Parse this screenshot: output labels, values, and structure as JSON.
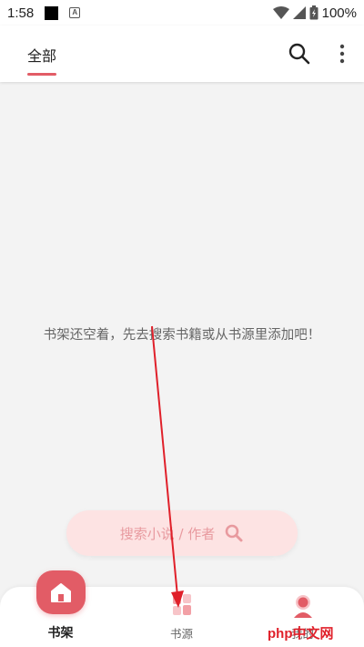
{
  "status_bar": {
    "time": "1:58",
    "battery": "100%"
  },
  "header": {
    "tab_all": "全部",
    "search_icon": "search-icon",
    "more_icon": "more-vert-icon"
  },
  "main": {
    "empty_message": "书架还空着，先去搜索书籍或从书源里添加吧！",
    "search_button_label": "搜索小说 / 作者"
  },
  "bottom_nav": {
    "shelf_label": "书架",
    "source_label": "书源",
    "mine_label": "我的"
  },
  "watermark": "php中文网",
  "colors": {
    "accent": "#e25c66",
    "pill_bg": "#fde3e3",
    "annotation": "#e0202a"
  }
}
